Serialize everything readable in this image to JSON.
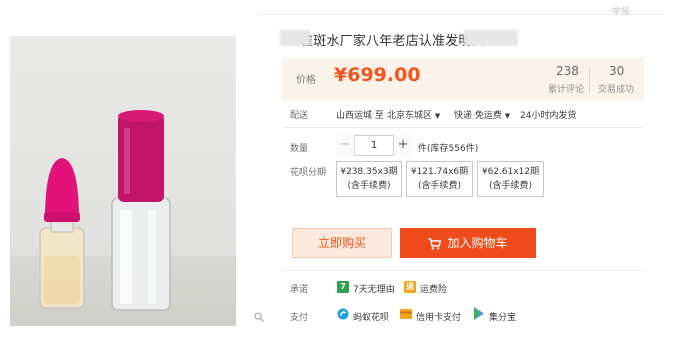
{
  "header": {
    "corner": "举报"
  },
  "product": {
    "title": "雀斑水厂家八年老店认准发明人",
    "image_alt_icon": "product-photo"
  },
  "price": {
    "label": "价格",
    "value": "¥699.00",
    "stats": [
      {
        "num": "238",
        "label": "累计评论"
      },
      {
        "num": "30",
        "label": "交易成功"
      }
    ]
  },
  "shipping": {
    "label": "配送",
    "from": "山西运城 至",
    "to": "北京东城区",
    "method": "快递 免运费",
    "time": "24小时内发货"
  },
  "quantity": {
    "label": "数量",
    "minus": "−",
    "value": "1",
    "plus": "+",
    "stock": "件(库存556件)"
  },
  "installments": {
    "label": "花呗分期",
    "options": [
      {
        "line1": "¥238.35x3期",
        "line2": "(含手续费)"
      },
      {
        "line1": "¥121.74x6期",
        "line2": "(含手续费)"
      },
      {
        "line1": "¥62.61x12期",
        "line2": "(含手续费)"
      }
    ]
  },
  "actions": {
    "buy_now": "立即购买",
    "add_to_cart": "加入购物车"
  },
  "promise": {
    "label": "承诺",
    "items": [
      {
        "badge": "7",
        "text": "7天无理由"
      },
      {
        "badge": "退",
        "text": "运费险"
      }
    ]
  },
  "payment": {
    "label": "支付",
    "items": [
      {
        "icon": "ant-huabei-icon",
        "text": "蚂蚁花呗"
      },
      {
        "icon": "credit-card-icon",
        "text": "信用卡支付"
      },
      {
        "icon": "jifenbao-icon",
        "text": "集分宝"
      }
    ]
  },
  "colors": {
    "accent": "#f2561c",
    "cart_button": "#f04b1c",
    "price_bg": "#fbf2ea"
  }
}
